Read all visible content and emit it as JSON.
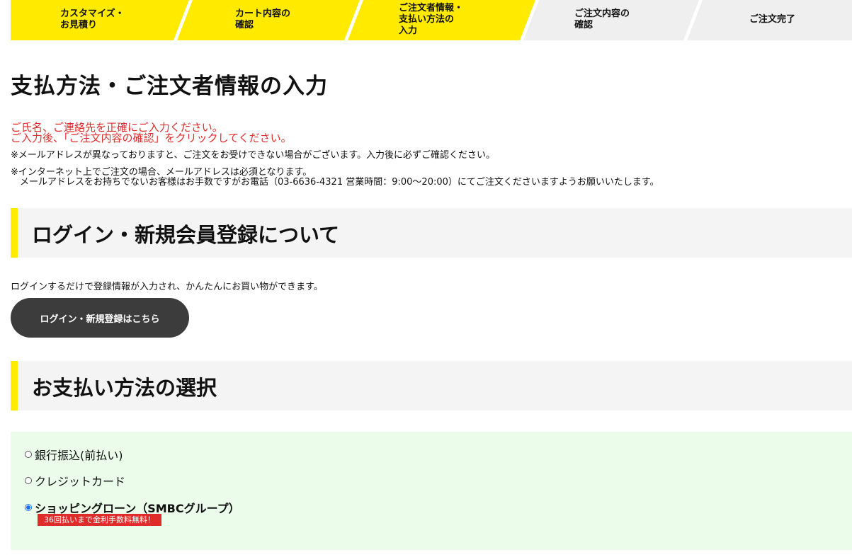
{
  "steps": [
    {
      "label": "カスタマイズ・\nお見積り",
      "status": "done"
    },
    {
      "label": "カート内容の\n確認",
      "status": "done"
    },
    {
      "label": "ご注文者情報・\n支払い方法の\n入力",
      "status": "current"
    },
    {
      "label": "ご注文内容の\n確認",
      "status": "pending"
    },
    {
      "label": "ご注文完了",
      "status": "pending"
    }
  ],
  "colors": {
    "step_active": "#ffea00",
    "step_inactive": "#efefef",
    "accent_red": "#e02b2b",
    "pay_box_bg": "#ebfdea"
  },
  "page_title": "支払方法・ご注文者情報の入力",
  "notices": {
    "red_line1": "ご氏名、ご連絡先を正確にご入力ください。",
    "red_line2": "ご入力後、「ご注文内容の確認」をクリックしてください。",
    "note1": "※メールアドレスが異なっておりますと、ご注文をお受けできない場合がございます。入力後に必ずご確認ください。",
    "note2_line1": "※インターネット上でご注文の場合、メールアドレスは必須となります。",
    "note2_line2": "　メールアドレスをお持ちでないお客様はお手数ですがお電話（03-6636-4321 営業時間：9:00〜20:00）にてご注文くださいますようお願いいたします。"
  },
  "login_section": {
    "heading": "ログイン・新規会員登録について",
    "description": "ログインするだけで登録情報が入力され、かんたんにお買い物ができます。",
    "button_label": "ログイン・新規登録はこちら"
  },
  "payment_section": {
    "heading": "お支払い方法の選択",
    "options": [
      {
        "label": "銀行振込(前払い)",
        "selected": false
      },
      {
        "label": "クレジットカード",
        "selected": false
      },
      {
        "label": "ショッピングローン（SMBCグループ）",
        "selected": true
      }
    ],
    "badge": "36回払いまで金利手数料無料！"
  }
}
